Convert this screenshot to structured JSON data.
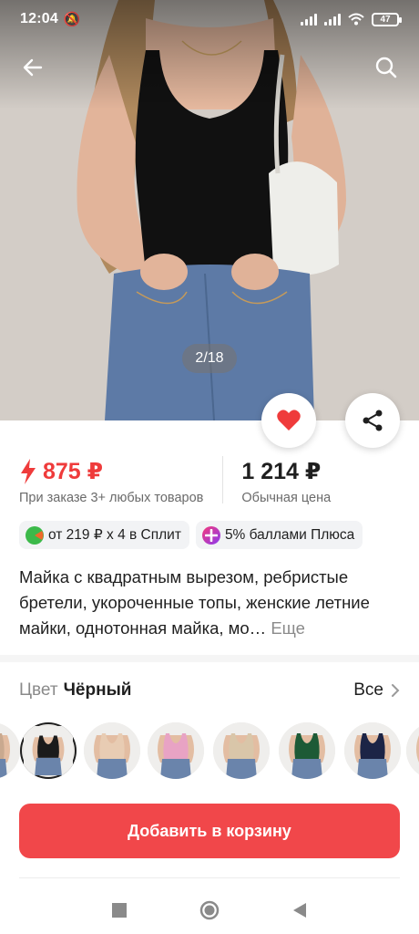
{
  "status_bar": {
    "time": "12:04",
    "battery": "47"
  },
  "gallery": {
    "counter": "2/18"
  },
  "price": {
    "split_price": "875 ₽",
    "split_note": "При заказе 3+ любых товаров",
    "regular_price": "1 214 ₽",
    "regular_note": "Обычная цена"
  },
  "promos": [
    {
      "label": "от 219 ₽ х 4 в Сплит",
      "icon": "split-pacman-icon"
    },
    {
      "label": "5% баллами Плюса",
      "icon": "plus-points-icon"
    }
  ],
  "product": {
    "title": "Майка с квадратным вырезом, ребристые бретели, укороченные топы, женские летние майки, однотонная майка, мо…",
    "more": "Еще"
  },
  "color": {
    "label": "Цвет",
    "value": "Чёрный",
    "all_label": "Все",
    "swatch_colors": [
      "#c9a98f",
      "#1b1b1b",
      "#e8ccb3",
      "#e8a3c4",
      "#d9c6a9",
      "#1d5a36",
      "#1c2446",
      "#6e6157"
    ]
  },
  "cta": {
    "add_to_cart": "Добавить в корзину"
  },
  "colors": {
    "accent": "#ef3b3b",
    "cta": "#f1474a"
  }
}
